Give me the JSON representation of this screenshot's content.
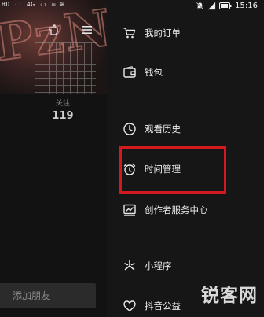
{
  "status_bar": {
    "left_indicators": "HD ᵢₗ 4G ᵢₗ ✉ ≋",
    "time": "15:16"
  },
  "profile": {
    "following_label": "关注",
    "following_count": "119",
    "add_friend_label": "添加朋友"
  },
  "drawer": {
    "items": [
      {
        "label": "我的订单",
        "icon": "cart-icon"
      },
      {
        "label": "钱包",
        "icon": "wallet-icon"
      },
      {
        "label": "观看历史",
        "icon": "clock-icon"
      },
      {
        "label": "时间管理",
        "icon": "alarm-clock-icon"
      },
      {
        "label": "创作者服务中心",
        "icon": "chart-icon"
      },
      {
        "label": "小程序",
        "icon": "mini-program-icon"
      },
      {
        "label": "抖音公益",
        "icon": "heart-hands-icon"
      }
    ]
  },
  "highlight_color": "#d3181e",
  "watermark": "锐客网"
}
